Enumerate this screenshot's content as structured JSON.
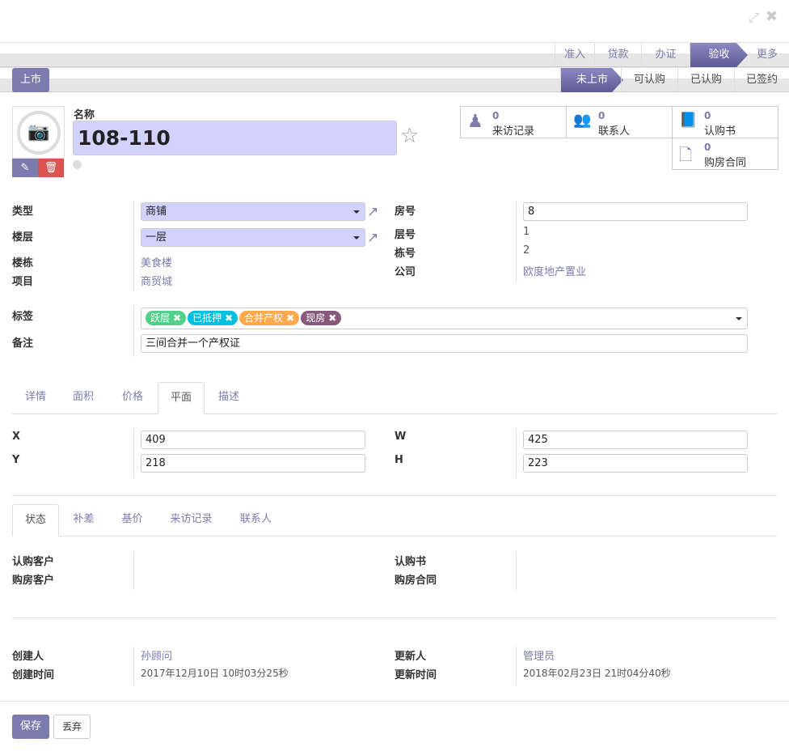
{
  "window": {
    "expand_icon": "expand-icon",
    "close_icon": "close-icon"
  },
  "statusbar1": {
    "steps": [
      "准入",
      "贷款",
      "办证",
      "验收",
      "更多"
    ],
    "active": "验收"
  },
  "statusbar2": {
    "action_button": "上市",
    "steps": [
      "未上市",
      "可认购",
      "已认购",
      "已签约"
    ],
    "active": "未上市"
  },
  "header": {
    "name_label": "名称",
    "name_value": "108-110"
  },
  "smart_buttons": [
    {
      "count": "0",
      "label": "来访记录",
      "icon": "user-icon"
    },
    {
      "count": "0",
      "label": "联系人",
      "icon": "users-icon"
    },
    {
      "count": "0",
      "label": "认购书",
      "icon": "book-icon"
    },
    {
      "count": "0",
      "label": "购房合同",
      "icon": "file-icon"
    }
  ],
  "fields": {
    "type": {
      "label": "类型",
      "value": "商铺"
    },
    "floor": {
      "label": "楼层",
      "value": "一层"
    },
    "building": {
      "label": "楼栋",
      "value": "美食楼"
    },
    "project": {
      "label": "项目",
      "value": "商贸城"
    },
    "room_no": {
      "label": "房号",
      "value": "8"
    },
    "floor_no": {
      "label": "层号",
      "value": "1"
    },
    "building_no": {
      "label": "栋号",
      "value": "2"
    },
    "company": {
      "label": "公司",
      "value": "欧度地产置业"
    },
    "tags_label": "标签",
    "tags": [
      {
        "label": "跃层",
        "color": "#4fd18b"
      },
      {
        "label": "已抵押",
        "color": "#00c0e0"
      },
      {
        "label": "合并产权",
        "color": "#ffa94d"
      },
      {
        "label": "现房",
        "color": "#875a7b"
      }
    ],
    "notes": {
      "label": "备注",
      "value": "三间合并一个产权证"
    }
  },
  "tabs1": {
    "items": [
      "详情",
      "面积",
      "价格",
      "平面",
      "描述"
    ],
    "active": "平面"
  },
  "plane": {
    "x": {
      "label": "X",
      "value": "409"
    },
    "y": {
      "label": "Y",
      "value": "218"
    },
    "w": {
      "label": "W",
      "value": "425"
    },
    "h": {
      "label": "H",
      "value": "223"
    }
  },
  "tabs2": {
    "items": [
      "状态",
      "补差",
      "基价",
      "来访记录",
      "联系人"
    ],
    "active": "状态"
  },
  "status": {
    "subscriber": "认购客户",
    "buyer": "购房客户",
    "subscription": "认购书",
    "contract": "购房合同"
  },
  "meta": {
    "created_by_label": "创建人",
    "created_by": "孙顾问",
    "created_at_label": "创建时间",
    "created_at": "2017年12月10日 10时03分25秒",
    "updated_by_label": "更新人",
    "updated_by": "管理员",
    "updated_at_label": "更新时间",
    "updated_at": "2018年02月23日 21时04分40秒"
  },
  "footer": {
    "save": "保存",
    "discard": "丢弃"
  },
  "colors": {
    "primary": "#7c7bad",
    "danger": "#d9534f",
    "required": "#d2d2ff"
  }
}
